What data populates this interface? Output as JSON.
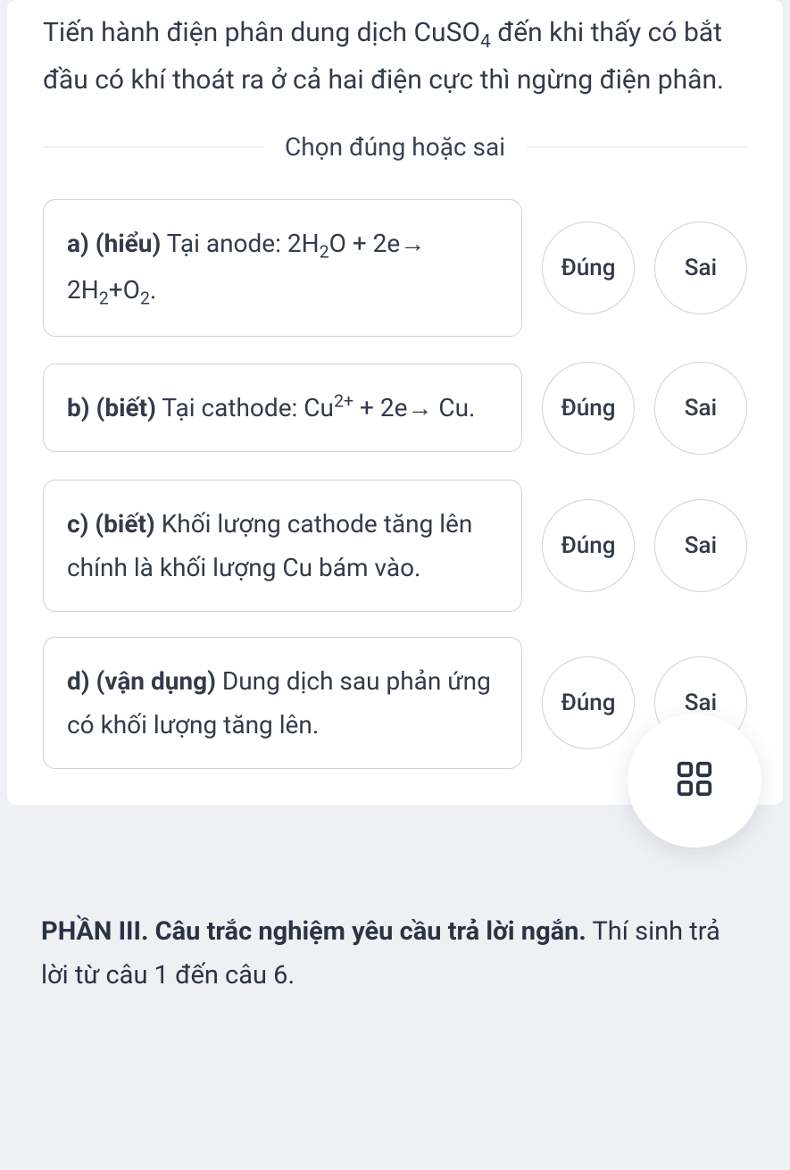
{
  "question": {
    "html": "Tiến hành điện phân dung dịch CuSO<sub>4</sub> đến khi thấy có bắt đầu có khí thoát ra ở cả hai điện cực thì ngừng điện phân."
  },
  "divider_label": "Chọn đúng hoặc sai",
  "true_label": "Đúng",
  "false_label": "Sai",
  "options": [
    {
      "tag": "a) (hiểu)",
      "text_html": " Tại anode: 2H<sub>2</sub>O + 2e&#x2192; 2H<sub>2</sub>+O<sub>2</sub>."
    },
    {
      "tag": "b) (biết)",
      "text_html": " Tại cathode: Cu<sup>2+</sup> + 2e&#x2192; Cu."
    },
    {
      "tag": "c) (biết)",
      "text_html": " Khối lượng cathode tăng lên chính là khối lượng Cu bám vào."
    },
    {
      "tag": "d) (vận dụng)",
      "text_html": " Dung dịch sau phản ứng có khối lượng tăng lên."
    }
  ],
  "section3": {
    "bold": "PHẦN III. Câu trắc nghiệm yêu cầu trả lời ngắn.",
    "rest": " Thí sinh trả lời từ câu 1 đến câu 6."
  }
}
